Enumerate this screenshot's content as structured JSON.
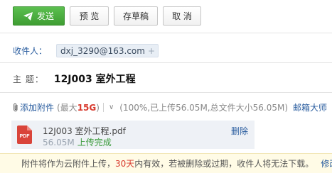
{
  "toolbar": {
    "send_label": "发送",
    "preview_label": "预 览",
    "draft_label": "存草稿",
    "cancel_label": "取 消"
  },
  "recipients": {
    "label": "收件人：",
    "chips": [
      "dxj_3290@163.com"
    ],
    "add_symbol": "+"
  },
  "subject": {
    "label": "主  题：",
    "value": "12J003 室外工程"
  },
  "attachments": {
    "add_label": "添加附件",
    "limit_prefix": "(最大",
    "limit_value": "15G",
    "limit_suffix": ")",
    "usage_text": "(100%,已上传56.05M,总文件大小56.05M)",
    "recv_link": "邮箱大师",
    "files": [
      {
        "icon_label": "PDF",
        "name": "12J003 室外工程.pdf",
        "size": "56.05M",
        "status": "上传完成",
        "delete_label": "删除"
      }
    ]
  },
  "notice": {
    "text_before": "附件将作为云附件上传，",
    "days": "30天",
    "text_after": "内有效，若被删除或过期，收件人将无法下载。",
    "modify_link": "修改"
  },
  "colors": {
    "send_button": "#44a63a",
    "link": "#2a5d9f",
    "highlight_red": "#d83a2e",
    "success_green": "#3a9a3a",
    "notice_bg": "#fffbe6"
  }
}
